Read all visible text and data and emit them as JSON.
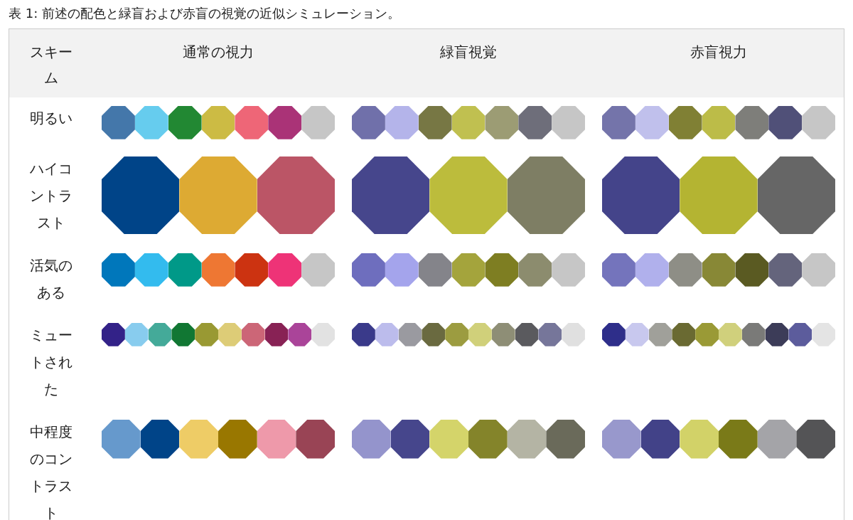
{
  "caption": "表 1: 前述の配色と緑盲および赤盲の視覚の近似シミュレーション。",
  "columns": [
    "スキーム",
    "通常の視力",
    "緑盲視覚",
    "赤盲視力"
  ],
  "rows": [
    {
      "scheme": "明るい",
      "cells": [
        {
          "swatches": [
            {
              "color": "#4477aa"
            },
            {
              "color": "#66ccee"
            },
            {
              "color": "#228833"
            },
            {
              "color": "#ccbb44"
            },
            {
              "color": "#ee6677"
            },
            {
              "color": "#aa3377"
            },
            {
              "color": "#c6c6c6"
            }
          ]
        },
        {
          "swatches": [
            {
              "color": "#7070aa"
            },
            {
              "color": "#b4b4ea"
            },
            {
              "color": "#777744"
            },
            {
              "color": "#c0c050"
            },
            {
              "color": "#9c9c74"
            },
            {
              "color": "#6e6e7a"
            },
            {
              "color": "#c6c6c6"
            }
          ]
        },
        {
          "swatches": [
            {
              "color": "#7474aa"
            },
            {
              "color": "#c0c0ec"
            },
            {
              "color": "#808034"
            },
            {
              "color": "#bcbc48"
            },
            {
              "color": "#7e7e7a"
            },
            {
              "color": "#505078"
            },
            {
              "color": "#c6c6c6"
            }
          ]
        }
      ]
    },
    {
      "scheme": "ハイコントラスト",
      "cells": [
        {
          "swatches": [
            {
              "color": "#004488"
            },
            {
              "color": "#ddaa33"
            },
            {
              "color": "#bb5566"
            }
          ]
        },
        {
          "swatches": [
            {
              "color": "#46468c"
            },
            {
              "color": "#bcbc3c"
            },
            {
              "color": "#7e7e64"
            }
          ]
        },
        {
          "swatches": [
            {
              "color": "#44448a"
            },
            {
              "color": "#b4b432"
            },
            {
              "color": "#666666"
            }
          ]
        }
      ]
    },
    {
      "scheme": "活気のある",
      "cells": [
        {
          "swatches": [
            {
              "color": "#0077bb"
            },
            {
              "color": "#33bbee"
            },
            {
              "color": "#009988"
            },
            {
              "color": "#ee7733"
            },
            {
              "color": "#cc3311"
            },
            {
              "color": "#ee3377"
            },
            {
              "color": "#c6c6c6"
            }
          ]
        },
        {
          "swatches": [
            {
              "color": "#6e6ebe"
            },
            {
              "color": "#a4a4ec"
            },
            {
              "color": "#84848a"
            },
            {
              "color": "#a4a43c"
            },
            {
              "color": "#7e7e22"
            },
            {
              "color": "#8c8c6e"
            },
            {
              "color": "#c6c6c6"
            }
          ]
        },
        {
          "swatches": [
            {
              "color": "#7474bc"
            },
            {
              "color": "#b0b0ec"
            },
            {
              "color": "#8e8e86"
            },
            {
              "color": "#888836"
            },
            {
              "color": "#5a5a22"
            },
            {
              "color": "#64647c"
            },
            {
              "color": "#c6c6c6"
            }
          ]
        }
      ]
    },
    {
      "scheme": "ミュートされた",
      "cells": [
        {
          "swatches": [
            {
              "color": "#332288"
            },
            {
              "color": "#88ccee"
            },
            {
              "color": "#44aa99"
            },
            {
              "color": "#117733"
            },
            {
              "color": "#999933"
            },
            {
              "color": "#ddcc77"
            },
            {
              "color": "#cc6677"
            },
            {
              "color": "#882255"
            },
            {
              "color": "#aa4499"
            },
            {
              "color": "#e2e2e2"
            }
          ]
        },
        {
          "swatches": [
            {
              "color": "#3a3a8a"
            },
            {
              "color": "#bcbcec"
            },
            {
              "color": "#9a9aa0"
            },
            {
              "color": "#6a6a40"
            },
            {
              "color": "#9c9c40"
            },
            {
              "color": "#d0d07a"
            },
            {
              "color": "#8e8e76"
            },
            {
              "color": "#5a5a5e"
            },
            {
              "color": "#76769a"
            },
            {
              "color": "#e0e0e0"
            }
          ]
        },
        {
          "swatches": [
            {
              "color": "#2e2e8a"
            },
            {
              "color": "#c8c8ee"
            },
            {
              "color": "#a0a09a"
            },
            {
              "color": "#6a6a32"
            },
            {
              "color": "#9a9a36"
            },
            {
              "color": "#d0d07c"
            },
            {
              "color": "#7a7a78"
            },
            {
              "color": "#3c3c58"
            },
            {
              "color": "#5c5c9c"
            },
            {
              "color": "#e4e4e4"
            }
          ]
        }
      ]
    },
    {
      "scheme": "中程度のコントラスト",
      "cells": [
        {
          "swatches": [
            {
              "color": "#6699cc"
            },
            {
              "color": "#004488"
            },
            {
              "color": "#eecc66"
            },
            {
              "color": "#997700"
            },
            {
              "color": "#ee99aa"
            },
            {
              "color": "#994455"
            }
          ]
        },
        {
          "swatches": [
            {
              "color": "#9494cc"
            },
            {
              "color": "#46468c"
            },
            {
              "color": "#d4d46a"
            },
            {
              "color": "#84842a"
            },
            {
              "color": "#b4b4a4"
            },
            {
              "color": "#6a6a5a"
            }
          ]
        },
        {
          "swatches": [
            {
              "color": "#9898cc"
            },
            {
              "color": "#424288"
            },
            {
              "color": "#d2d268"
            },
            {
              "color": "#7a7a18"
            },
            {
              "color": "#a4a4a8"
            },
            {
              "color": "#545456"
            }
          ]
        }
      ]
    }
  ]
}
